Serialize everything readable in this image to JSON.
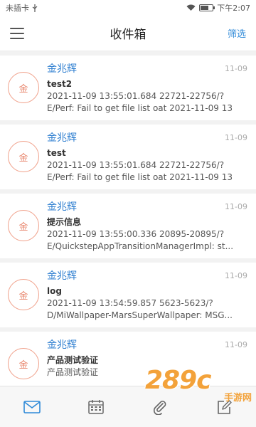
{
  "status_bar": {
    "left_text": "未插卡",
    "time": "下午2:07",
    "battery_level": 0.7
  },
  "app_bar": {
    "title": "收件箱",
    "filter_label": "筛选"
  },
  "avatar_text": "金",
  "messages": [
    {
      "sender": "金兆辉",
      "date": "11-09",
      "subject": "test2",
      "preview_line1": "2021-11-09 13:55:01.684 22721-22756/?",
      "preview_line2": "E/Perf: Fail to get file list oat 2021-11-09 13"
    },
    {
      "sender": "金兆辉",
      "date": "11-09",
      "subject": "test",
      "preview_line1": "2021-11-09 13:55:01.684 22721-22756/?",
      "preview_line2": "E/Perf: Fail to get file list oat 2021-11-09 13"
    },
    {
      "sender": "金兆辉",
      "date": "11-09",
      "subject": "提示信息",
      "preview_line1": "2021-11-09 13:55:00.336 20895-20895/?",
      "preview_line2": "E/QuickstepAppTransitionManagerImpl: st..."
    },
    {
      "sender": "金兆辉",
      "date": "11-09",
      "subject": "log",
      "preview_line1": "2021-11-09 13:54:59.857 5623-5623/?",
      "preview_line2": "D/MiWallpaper-MarsSuperWallpaper: MSG..."
    },
    {
      "sender": "金兆辉",
      "date": "11-09",
      "subject": "产品测试验证",
      "preview_line1": "产品测试验证",
      "preview_line2": ""
    }
  ],
  "tabs": [
    {
      "icon": "mail-icon",
      "active": true
    },
    {
      "icon": "calendar-icon",
      "active": false
    },
    {
      "icon": "attachment-icon",
      "active": false
    },
    {
      "icon": "compose-icon",
      "active": false
    }
  ],
  "watermark": {
    "digits": "289",
    "suffix": "c",
    "subtitle": "手游网"
  },
  "colors": {
    "accent": "#2f8ad8",
    "sender": "#2f7fd0",
    "avatar": "#e8856b",
    "watermark": "#f3a23a"
  }
}
